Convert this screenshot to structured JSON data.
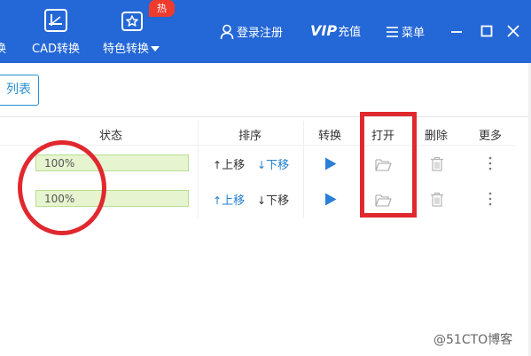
{
  "toolbar": {
    "cut_left_label": "换",
    "cad_convert_label": "CAD转换",
    "special_convert_label": "特色转换",
    "hot_badge": "热",
    "login_label": "登录注册",
    "vip_label": "VIP",
    "recharge_label": "充值",
    "menu_label": "菜单"
  },
  "list_button_label": "列表",
  "columns": {
    "status": "状态",
    "sort": "排序",
    "convert": "转换",
    "open": "打开",
    "delete": "删除",
    "more": "更多"
  },
  "rows": [
    {
      "progress": 1.0,
      "progress_text": "100%",
      "move_up": "上移",
      "move_down": "下移"
    },
    {
      "progress": 1.0,
      "progress_text": "100%",
      "move_up": "上移",
      "move_down": "下移"
    }
  ],
  "watermark": "@51CTO博客",
  "colors": {
    "topbar": "#2467d6",
    "accent": "#1f7fd2",
    "annotation": "#e0282e",
    "progress_fill": "#e6f5cf",
    "hot_badge": "#ef3b2d"
  },
  "icons": [
    "cad-icon",
    "star-box-icon",
    "user-icon",
    "menu-icon",
    "minimize-icon",
    "maximize-icon",
    "close-icon",
    "play-icon",
    "folder-open-icon",
    "trash-icon",
    "more-vertical-icon"
  ]
}
